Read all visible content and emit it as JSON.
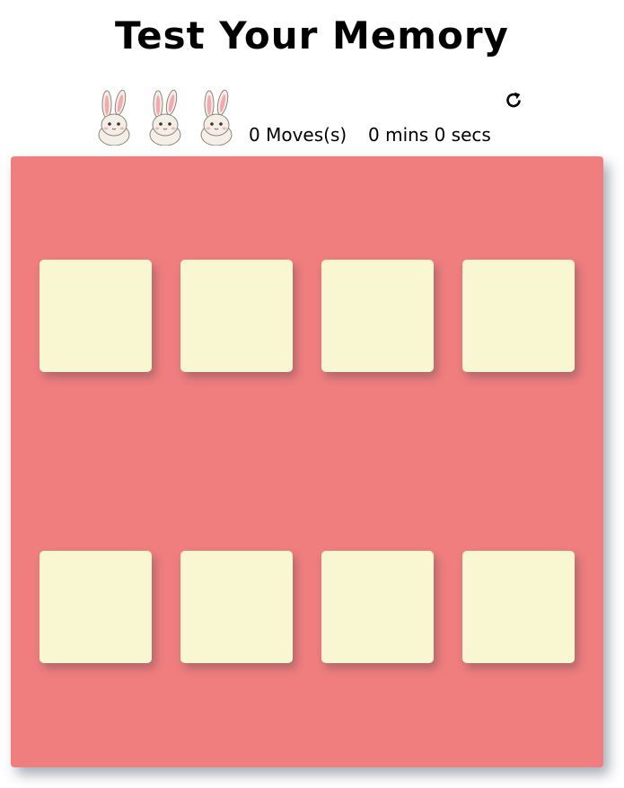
{
  "header": {
    "title": "Test Your Memory"
  },
  "score_panel": {
    "rating_icons": [
      "bunny-icon",
      "bunny-icon",
      "bunny-icon"
    ],
    "moves_count": "0",
    "moves_label": "Moves(s)",
    "timer_text": "0 mins 0 secs",
    "restart_icon": "restart-icon"
  },
  "deck": {
    "background_color": "#f07e7e",
    "card_color": "#f8f7d2",
    "card_count": 8
  }
}
